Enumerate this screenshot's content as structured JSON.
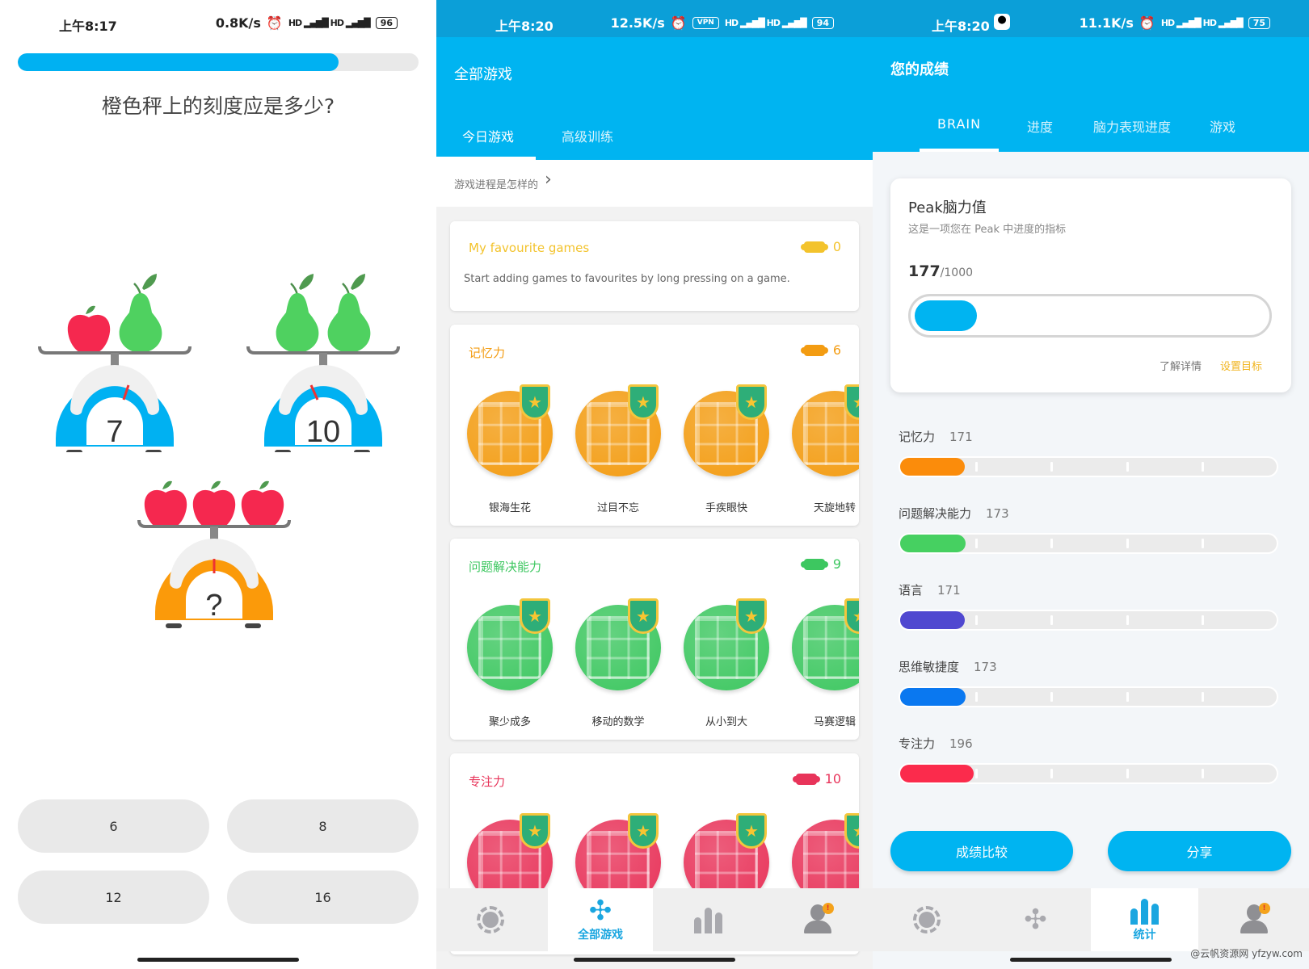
{
  "panel1": {
    "status": {
      "time": "上午8:17",
      "speed": "0.8K/s",
      "battery": "96"
    },
    "progress": 0.8,
    "question": "橙色秤上的刻度应是多少?",
    "scales": [
      {
        "fruits": [
          "apple",
          "pear"
        ],
        "reading": "7",
        "color": "#00b1f2"
      },
      {
        "fruits": [
          "pear",
          "pear"
        ],
        "reading": "10",
        "color": "#00b1f2"
      },
      {
        "fruits": [
          "apple",
          "apple",
          "apple"
        ],
        "reading": "?",
        "color": "#fb9a0a"
      }
    ],
    "answers": [
      "6",
      "8",
      "12",
      "16"
    ]
  },
  "panel2": {
    "status": {
      "time": "上午8:20",
      "speed": "12.5K/s",
      "vpn": "VPN",
      "battery": "94"
    },
    "title": "全部游戏",
    "tabs": [
      "今日游戏",
      "高级训练"
    ],
    "progress_link": "游戏进程是怎样的",
    "favourites": {
      "title": "My favourite games",
      "count": "0",
      "hint": "Start adding games to favourites by long pressing on a game.",
      "color": "#f3c32c"
    },
    "categories": [
      {
        "title": "记忆力",
        "count": "6",
        "color": "#f39c12",
        "games": [
          "银海生花",
          "过目不忘",
          "手疾眼快",
          "天旋地转"
        ]
      },
      {
        "title": "问题解决能力",
        "count": "9",
        "color": "#3dc760",
        "games": [
          "聚少成多",
          "移动的数学",
          "从小到大",
          "马赛逻辑"
        ]
      },
      {
        "title": "专注力",
        "count": "10",
        "color": "#e8345a",
        "games": [
          "",
          "",
          "",
          ""
        ]
      }
    ],
    "nav": {
      "active_label": "全部游戏"
    }
  },
  "panel3": {
    "status": {
      "time": "上午8:20",
      "speed": "11.1K/s",
      "battery": "75"
    },
    "title": "您的成绩",
    "tabs": [
      "BRAIN",
      "进度",
      "脑力表现进度",
      "游戏"
    ],
    "peak": {
      "title": "Peak脑力值",
      "subtitle": "这是一项您在 Peak 中进度的指标",
      "value": "177",
      "max": "/1000",
      "fraction": 0.177,
      "learn_more": "了解详情",
      "set_goal": "设置目标"
    },
    "scores": [
      {
        "label": "记忆力",
        "value": "171",
        "color": "#fb8c0b"
      },
      {
        "label": "问题解决能力",
        "value": "173",
        "color": "#46d061"
      },
      {
        "label": "语言",
        "value": "171",
        "color": "#5048d0"
      },
      {
        "label": "思维敏捷度",
        "value": "173",
        "color": "#0a78f0"
      },
      {
        "label": "专注力",
        "value": "196",
        "color": "#fb2b4c"
      }
    ],
    "score_max": 1000,
    "buttons": {
      "compare": "成绩比较",
      "share": "分享"
    },
    "nav": {
      "active_label": "统计"
    },
    "watermark": "@云帆资源网 yfzyw.com"
  }
}
